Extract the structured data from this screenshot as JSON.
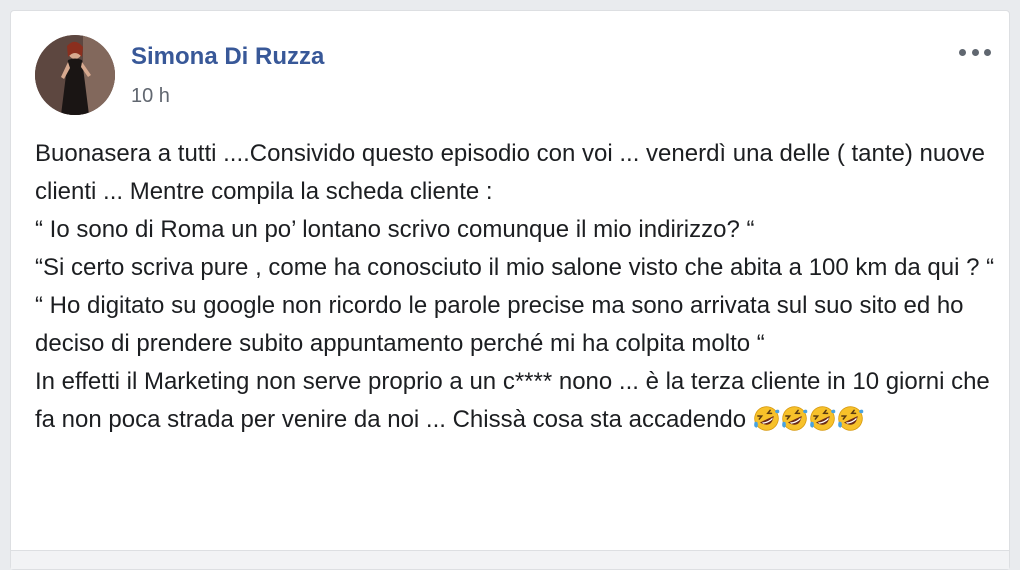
{
  "post": {
    "author": "Simona Di Ruzza",
    "timestamp": "10 h",
    "lines": [
      "Buonasera a tutti ....Consivido questo episodio con voi ... venerdì una delle ( tante) nuove clienti ... Mentre compila la scheda cliente :",
      "“ Io sono di Roma un po’ lontano scrivo comunque il mio indirizzo? “",
      "“Si certo scriva pure , come ha conosciuto il mio salone visto che abita a 100 km da qui ? “",
      "“ Ho digitato su google non ricordo le parole precise ma sono arrivata sul suo sito ed ho deciso di prendere subito appuntamento perché mi ha colpita molto “",
      "In effetti il Marketing non serve proprio a un c**** nono ... è la terza cliente in 10 giorni che fa non poca strada per venire da noi ... Chissà cosa sta accadendo "
    ],
    "emojis": [
      "rolling-on-floor-laughing",
      "rolling-on-floor-laughing",
      "rolling-on-floor-laughing",
      "rolling-on-floor-laughing"
    ]
  },
  "icons": {
    "more_options": "ellipsis-icon"
  },
  "colors": {
    "author_link": "#385898",
    "meta_text": "#616770",
    "body_text": "#1c1e21",
    "emoji_face": "#f7c12a"
  }
}
